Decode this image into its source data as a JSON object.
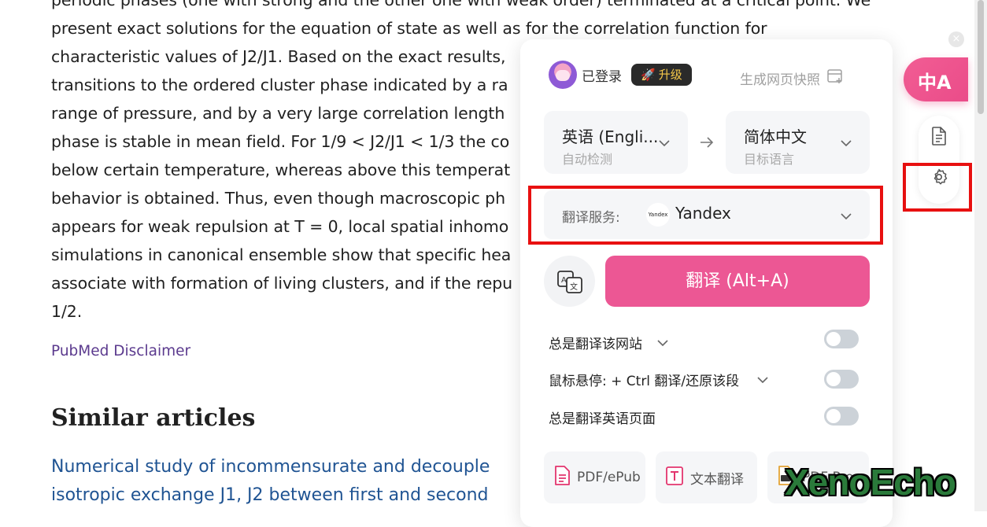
{
  "article": {
    "lines": [
      "periodic phases (one with strong and the other one with weak order) terminated at a critical point. We",
      "present exact solutions for the equation of state as well as for the correlation function for",
      "characteristic values of J2/J1. Based on the exact results, ",
      "transitions to the ordered cluster phase indicated by a ra",
      "range of pressure, and by a very large correlation length",
      "phase is stable in mean field. For 1/9 < J2/J1 < 1/3 the co",
      "below certain temperature, whereas above this temperat",
      "behavior is obtained. Thus, even though macroscopic ph",
      "appears for weak repulsion at T = 0, local spatial inhomo",
      "simulations in canonical ensemble show that specific hea",
      "associate with formation of living clusters, and if the repu",
      "1/2."
    ],
    "disclaimer": "PubMed Disclaimer",
    "similar_heading": "Similar articles",
    "similar_lines": [
      "Numerical study of incommensurate and decouple",
      "isotropic exchange J1, J2 between first and second"
    ]
  },
  "panel": {
    "user_label": "已登录",
    "upgrade_label": "升级",
    "snapshot_label": "生成网页快照",
    "source_lang": {
      "main": "英语 (Engli...",
      "sub": "自动检测"
    },
    "target_lang": {
      "main": "简体中文",
      "sub": "目标语言"
    },
    "service": {
      "label": "翻译服务:",
      "logo_text": "Yandex",
      "name": "Yandex"
    },
    "translate_button": "翻译 (Alt+A)",
    "options": [
      {
        "text": "总是翻译该网站"
      },
      {
        "text": "鼠标悬停:  + Ctrl 翻译/还原该段"
      },
      {
        "text": "总是翻译英语页面"
      }
    ],
    "tools": [
      {
        "label": "PDF/ePub",
        "icon": "pdf-icon"
      },
      {
        "label": "文本翻译",
        "icon": "text-translate-icon"
      },
      {
        "label": "PDF Pro",
        "icon": "pdf-pro-icon"
      }
    ]
  },
  "float": {
    "close_glyph": "×",
    "translate_glyph": "中A"
  },
  "watermark": "XenoEcho",
  "colors": {
    "accent": "#ec5794",
    "highlight_box": "#e81010",
    "link": "#205493"
  }
}
